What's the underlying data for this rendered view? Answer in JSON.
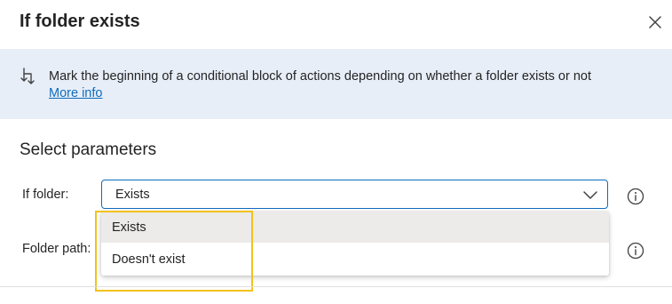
{
  "dialog": {
    "title": "If folder exists"
  },
  "banner": {
    "icon": "conditional-branch-icon",
    "text": "Mark the beginning of a conditional block of actions depending on whether a folder exists or not",
    "link_label": "More info"
  },
  "parameters": {
    "section_title": "Select parameters",
    "if_folder": {
      "label": "If folder:",
      "value": "Exists"
    },
    "folder_path": {
      "label": "Folder path:"
    }
  },
  "dropdown": {
    "options": [
      {
        "label": "Exists",
        "selected": true
      },
      {
        "label": "Doesn't exist",
        "selected": false
      }
    ]
  },
  "colors": {
    "banner_bg": "#e7eef8",
    "link": "#0f6cbd",
    "select_border": "#0f6cbd",
    "highlight": "#f2c21b",
    "selected_option_bg": "#ecebe9"
  }
}
